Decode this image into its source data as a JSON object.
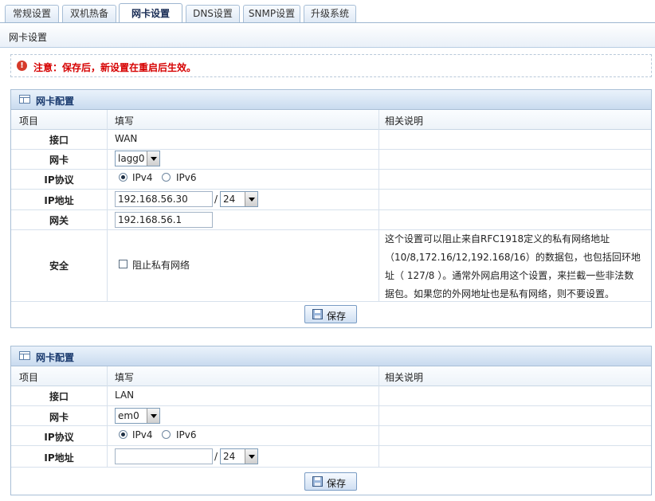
{
  "tabs": [
    {
      "label": "常规设置",
      "active": false
    },
    {
      "label": "双机热备",
      "active": false
    },
    {
      "label": "网卡设置",
      "active": true
    },
    {
      "label": "DNS设置",
      "active": false
    },
    {
      "label": "SNMP设置",
      "active": false
    },
    {
      "label": "升级系统",
      "active": false
    }
  ],
  "page_title": "网卡设置",
  "notice": {
    "icon": "alert-icon",
    "icon_glyph": "!",
    "text": "注意：保存后，新设置在重启后生效。"
  },
  "columns": {
    "item": "项目",
    "fill": "填写",
    "desc": "相关说明"
  },
  "wan": {
    "title": "网卡配置",
    "interface_label": "接口",
    "interface_value": "WAN",
    "nic_label": "网卡",
    "nic_value": "lagg0",
    "ip_proto_label": "IP协议",
    "ipv4_label": "IPv4",
    "ipv6_label": "IPv6",
    "selected": "IPv4",
    "ip_label": "IP地址",
    "ip_value": "192.168.56.30",
    "slash": "/",
    "mask_value": "24",
    "gateway_label": "网关",
    "gateway_value": "192.168.56.1",
    "security_label": "安全",
    "block_private_label": "阻止私有网络",
    "block_private_checked": false,
    "security_desc": [
      "这个设置可以阻止来自RFC1918定义的私有网络地址",
      "（10/8,172.16/12,192.168/16）的数据包，也包括回环地",
      "址（ 127/8 ）。通常外网启用这个设置，来拦截一些非法数",
      "据包。如果您的外网地址也是私有网络，则不要设置。"
    ],
    "save_label": "保存"
  },
  "lan": {
    "title": "网卡配置",
    "interface_label": "接口",
    "interface_value": "LAN",
    "nic_label": "网卡",
    "nic_value": "em0",
    "ip_proto_label": "IP协议",
    "ipv4_label": "IPv4",
    "ipv6_label": "IPv6",
    "selected": "IPv4",
    "ip_label": "IP地址",
    "ip_value": "",
    "slash": "/",
    "mask_value": "24",
    "save_label": "保存"
  }
}
